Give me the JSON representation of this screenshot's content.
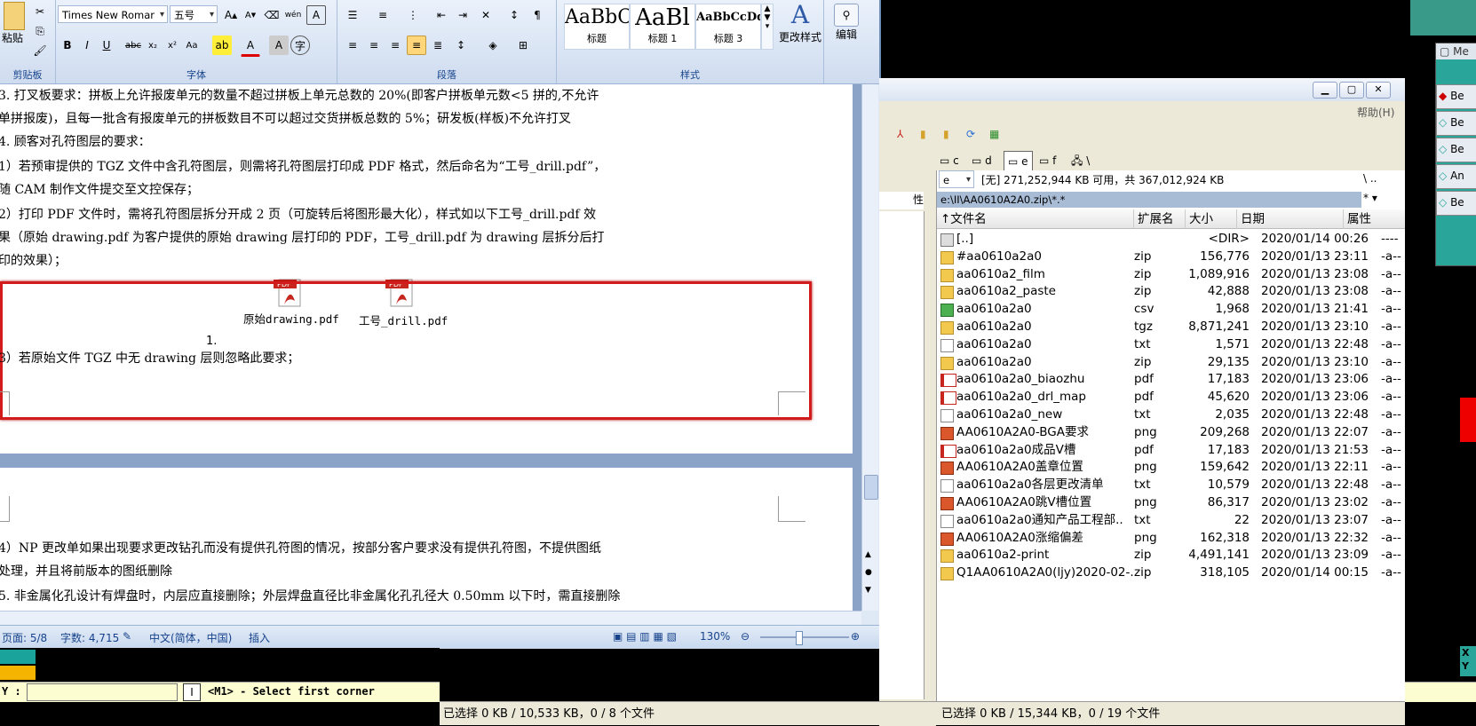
{
  "word": {
    "ribbon": {
      "clipboard": {
        "paste": "粘贴",
        "group_label": "剪贴板"
      },
      "font": {
        "family": "Times New Romar",
        "size": "五号",
        "group_label": "字体",
        "wen": "wén"
      },
      "paragraph": {
        "group_label": "段落"
      },
      "styles": {
        "group_label": "样式",
        "items": [
          {
            "preview": "AaBbC",
            "caption": "标题"
          },
          {
            "preview": "AaBl",
            "caption": "标题 1"
          },
          {
            "preview": "AaBbCcDd",
            "caption": "标题 3"
          }
        ],
        "change_styles": "更改样式"
      },
      "edit": {
        "label": "编辑"
      }
    },
    "doc": {
      "lines": [
        "3.   打叉板要求：拼板上允许报废单元的数量不超过拼板上单元总数的 20%(即客户拼板单元数<5 拼的,不允许",
        "      单拼报废)，且每一批含有报废单元的拼板数目不可以超过交货拼板总数的 5%；研发板(样板)不允许打叉",
        "4.   顾客对孔符图层的要求：",
        "      1）若预审提供的 TGZ 文件中含孔符图层，则需将孔符图层打印成 PDF 格式，然后命名为“工号_drill.pdf”，",
        "         随 CAM 制作文件提交至文控保存；",
        "      2）打印 PDF 文件时，需将孔符图层拆分开成 2 页（可旋转后将图形最大化），样式如以下工号_drill.pdf 效",
        "         果（原始 drawing.pdf 为客户提供的原始 drawing 层打印的 PDF，工号_drill.pdf 为 drawing 层拆分后打",
        "         印的效果）；"
      ],
      "attachments": [
        {
          "name": "原始drawing.pdf",
          "badge": "PDF"
        },
        {
          "name": "工号_drill.pdf",
          "badge": "PDF"
        }
      ],
      "numbering": "1.",
      "line_after": "      3）若原始文件 TGZ 中无 drawing 层则忽略此要求；",
      "page2_lines": [
        "      4）NP 更改单如果出现要求更改钻孔而没有提供孔符图的情况，按部分客户要求没有提供孔符图，不提供图纸",
        "         处理，并且将前版本的图纸删除",
        "5.   非金属化孔设计有焊盘时，内层应直接删除；外层焊盘直径比非金属化孔孔径大 0.50mm 以下时，需直接删除"
      ]
    },
    "status": {
      "page": "页面: 5/8",
      "words": "字数: 4,715",
      "language": "中文(简体，中国)",
      "mode": "插入",
      "zoom": "130%"
    }
  },
  "filemanager": {
    "help": "帮助(H)",
    "drives": [
      "c",
      "d",
      "e",
      "f",
      "\\"
    ],
    "current_drive": "e",
    "free_space": "[无]  271,252,944 KB 可用，共 367,012,924 KB",
    "path": "e:\\II\\AA0610A2A0.zip\\*.*",
    "left_header": "性",
    "columns": {
      "name": "↑文件名",
      "ext": "扩展名",
      "size": "大小",
      "date": "日期",
      "attr": "属性"
    },
    "files": [
      {
        "name": "[..]",
        "ext": "",
        "size": "<DIR>",
        "date": "2020/01/14 00:26",
        "attr": "----",
        "icon": "up-icon"
      },
      {
        "name": "#aa0610a2a0",
        "ext": "zip",
        "size": "156,776",
        "date": "2020/01/13 23:11",
        "attr": "-a--",
        "icon": "zip-icon"
      },
      {
        "name": "aa0610a2_film",
        "ext": "zip",
        "size": "1,089,916",
        "date": "2020/01/13 23:08",
        "attr": "-a--",
        "icon": "zip-icon"
      },
      {
        "name": "aa0610a2_paste",
        "ext": "zip",
        "size": "42,888",
        "date": "2020/01/13 23:08",
        "attr": "-a--",
        "icon": "zip-icon"
      },
      {
        "name": "aa0610a2a0",
        "ext": "csv",
        "size": "1,968",
        "date": "2020/01/13 21:41",
        "attr": "-a--",
        "icon": "csv-icon"
      },
      {
        "name": "aa0610a2a0",
        "ext": "tgz",
        "size": "8,871,241",
        "date": "2020/01/13 23:10",
        "attr": "-a--",
        "icon": "zip-icon"
      },
      {
        "name": "aa0610a2a0",
        "ext": "txt",
        "size": "1,571",
        "date": "2020/01/13 22:48",
        "attr": "-a--",
        "icon": "txt-icon"
      },
      {
        "name": "aa0610a2a0",
        "ext": "zip",
        "size": "29,135",
        "date": "2020/01/13 23:10",
        "attr": "-a--",
        "icon": "zip-icon"
      },
      {
        "name": "aa0610a2a0_biaozhu",
        "ext": "pdf",
        "size": "17,183",
        "date": "2020/01/13 23:06",
        "attr": "-a--",
        "icon": "pdf-icon"
      },
      {
        "name": "aa0610a2a0_drl_map",
        "ext": "pdf",
        "size": "45,620",
        "date": "2020/01/13 23:06",
        "attr": "-a--",
        "icon": "pdf-icon"
      },
      {
        "name": "aa0610a2a0_new",
        "ext": "txt",
        "size": "2,035",
        "date": "2020/01/13 22:48",
        "attr": "-a--",
        "icon": "txt-icon"
      },
      {
        "name": "AA0610A2A0-BGA要求",
        "ext": "png",
        "size": "209,268",
        "date": "2020/01/13 22:07",
        "attr": "-a--",
        "icon": "png-icon"
      },
      {
        "name": "aa0610a2a0成品V槽",
        "ext": "pdf",
        "size": "17,183",
        "date": "2020/01/13 21:53",
        "attr": "-a--",
        "icon": "pdf-icon"
      },
      {
        "name": "AA0610A2A0盖章位置",
        "ext": "png",
        "size": "159,642",
        "date": "2020/01/13 22:11",
        "attr": "-a--",
        "icon": "png-icon"
      },
      {
        "name": "aa0610a2a0各层更改清单",
        "ext": "txt",
        "size": "10,579",
        "date": "2020/01/13 22:48",
        "attr": "-a--",
        "icon": "txt-icon"
      },
      {
        "name": "AA0610A2A0跳V槽位置",
        "ext": "png",
        "size": "86,317",
        "date": "2020/01/13 23:02",
        "attr": "-a--",
        "icon": "png-icon"
      },
      {
        "name": "aa0610a2a0通知产品工程部..",
        "ext": "txt",
        "size": "22",
        "date": "2020/01/13 23:07",
        "attr": "-a--",
        "icon": "txt-icon"
      },
      {
        "name": "AA0610A2A0涨缩偏差",
        "ext": "png",
        "size": "162,318",
        "date": "2020/01/13 22:32",
        "attr": "-a--",
        "icon": "png-icon"
      },
      {
        "name": "aa0610a2-print",
        "ext": "zip",
        "size": "4,491,141",
        "date": "2020/01/13 23:09",
        "attr": "-a--",
        "icon": "zip-icon"
      },
      {
        "name": "Q1AA0610A2A0(ljy)2020-02-..",
        "ext": "zip",
        "size": "318,105",
        "date": "2020/01/14 00:15",
        "attr": "-a--",
        "icon": "zip-icon"
      }
    ],
    "left_status": "已选择 0 KB / 10,533 KB，0 / 8 个文件",
    "right_status": "已选择 0 KB / 15,344 KB，0 / 19 个文件"
  },
  "cam": {
    "prompt": "Y :",
    "input_value": "",
    "button": "I",
    "message": "<M1> - Select first corner",
    "side_title": "Me",
    "side_items": [
      "Be",
      "Be",
      "Be",
      "An",
      "Be"
    ],
    "xy": "X\nY"
  }
}
